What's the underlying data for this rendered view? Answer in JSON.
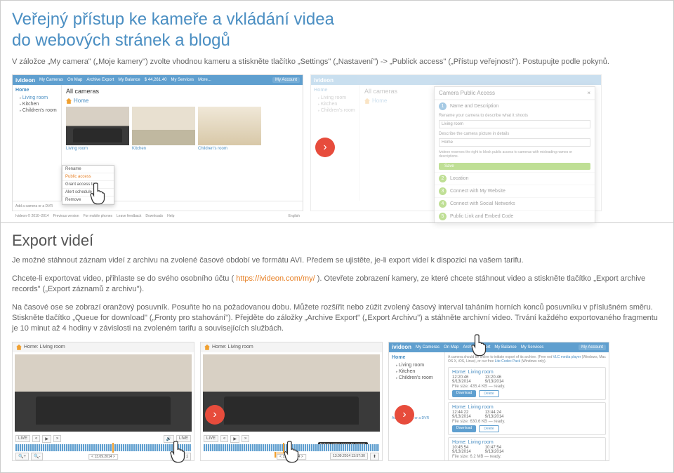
{
  "top": {
    "heading_l1": "Veřejný přístup ke kameře a vkládání videa",
    "heading_l2": "do webových stránek a blogů",
    "intro": "V záložce „My camera\" („Moje kamery\") zvolte vhodnou kameru a stiskněte tlačítko „Settings\" („Nastavení\") -> „Publick access\" („Přístup veřejnosti\"). Postupujte podle pokynů."
  },
  "app": {
    "logo": "ivideon",
    "nav": {
      "my_cameras": "My Cameras",
      "on_map": "On Map",
      "archive_export": "Archive Export",
      "my_balance": "My Balance",
      "balance_val": "$ 44,261.40",
      "my_services": "My Services",
      "more": "More..."
    },
    "account_btn": "My Account",
    "side": {
      "hdr": "Home",
      "items": [
        "Living room",
        "Kitchen",
        "Children's room"
      ]
    },
    "all_cameras": "All cameras",
    "home_label": "Home",
    "thumbs": {
      "living": "Living room",
      "kitchen": "Kitchen",
      "kids": "Children's room"
    },
    "ctx": {
      "rename": "Rename",
      "public": "Public access",
      "grant": "Grant access to",
      "alert": "Alert schedule",
      "remove": "Remove"
    },
    "footer": {
      "copy": "Ivideon © 2010–2014",
      "prev": "Previous version",
      "mobile": "For mobile phones",
      "feedback": "Leave feedback",
      "downloads": "Downloads",
      "help": "Help",
      "lang": "English",
      "add": "Add a camera or a DVR"
    }
  },
  "modal": {
    "title": "Camera Public Access",
    "close": "×",
    "s1_title": "Name and Description",
    "s1_sub": "Rename your camera to describe what it shoots",
    "s1_val": "Living room",
    "s1_desc_lbl": "Describe the camera picture in details",
    "s1_desc_val": "Home",
    "s1_note": "Ivideon reserves the right to block public access to cameras with misleading names or descriptions.",
    "s1_save": "Save",
    "s2": "Location",
    "s3": "Connect with My Website",
    "s4": "Connect with Social Networks",
    "s5": "Public Link and Embed Code"
  },
  "bottom": {
    "heading": "Export videí",
    "p1a": "Je možné stáhnout záznam videí z archivu na zvolené časové období ve formátu AVI. Předem se ujistěte, je-li export videí k dispozici na vašem tarifu.",
    "p2a": "Chcete-li exportovat video, přihlaste se do svého osobního účtu ( ",
    "p2link": "https://ivideon.com/my/",
    "p2b": " ). Otevřete zobrazení kamery, ze které chcete stáhnout video a stiskněte tlačítko „Export archive records\" („Export záznamů z archivu\").",
    "p3": "Na časové ose se zobrazí oranžový posuvník. Posuňte ho na požadovanou dobu. Můžete rozšířit nebo zúžit zvolený časový interval taháním horních konců posuvníku v příslušném směru. Stiskněte tlačítko „Queue for download\" („Fronty pro stahování\"). Přejděte do záložky „Archive Export\" („Export Archivu\") a stáhněte archivní video. Trvání každého exportovaného fragmentu je 10 minut až 4 hodiny v závislosti na zvoleném tarifu a souvisejících službách."
  },
  "viewer": {
    "title": "Home: Living room",
    "live": "LIVE",
    "date": "< 13.09.2014 >",
    "sel_tip": "Select a time range to export.",
    "sel_range": "13.09.2014 13:57:30"
  },
  "export": {
    "note_a": "A camera should be online to initiate export of its archive. (Free not ",
    "note_link": "VLC media player",
    "note_b": " (Windows, Mac OS X, iOS, Linux), or our free ",
    "note_link2": "Lite Codec Pack",
    "note_c": " (Windows only).",
    "recs": [
      {
        "name": "Home: Living room",
        "t1": "12:20:46",
        "d1": "9/13/2014",
        "t2": "13:20:46",
        "d2": "9/13/2014",
        "size": "File size: 435.4 KB — ready.",
        "btn1": "Download",
        "btn2": "Delete"
      },
      {
        "name": "Home: Living room",
        "t1": "12:44:22",
        "d1": "9/13/2014",
        "t2": "13:44:24",
        "d2": "9/13/2014",
        "size": "File size: 630.6 KB — ready.",
        "btn1": "Download",
        "btn2": "Delete"
      },
      {
        "name": "Home: Living room",
        "t1": "10:45:54",
        "d1": "9/13/2014",
        "t2": "10:47:54",
        "d2": "9/13/2014",
        "size": "File size: 6.2 MB — ready.",
        "progress": true
      }
    ]
  }
}
